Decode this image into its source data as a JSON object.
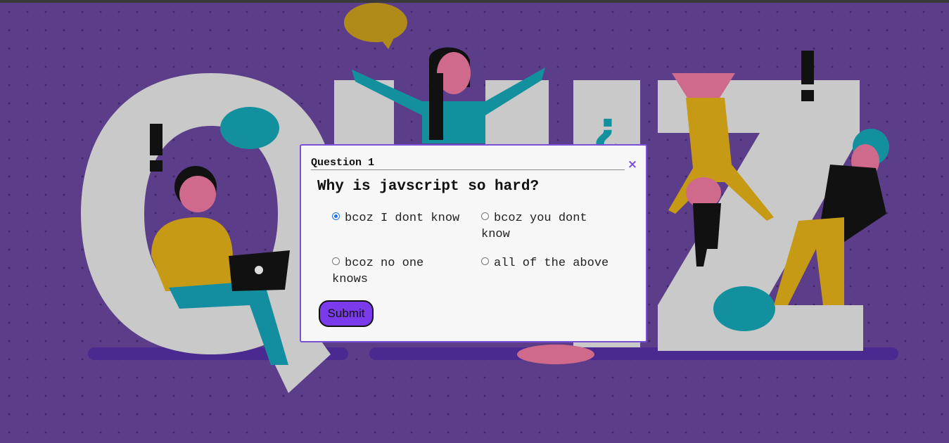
{
  "background": {
    "base_color": "#5b3d8a",
    "letter_color": "#cfcfcf",
    "accent_colors": [
      "#d4a017",
      "#13a2b3",
      "#e0588f",
      "#111111"
    ]
  },
  "modal": {
    "question_number": "Question 1",
    "close_label": "×",
    "question_text": "Why is javscript so hard?",
    "options": [
      {
        "label": "bcoz I dont know",
        "selected": true
      },
      {
        "label": "bcoz you dont know",
        "selected": false
      },
      {
        "label": "bcoz no one knows",
        "selected": false
      },
      {
        "label": "all of the above",
        "selected": false
      }
    ],
    "submit_label": "Submit",
    "accent_color": "#7c3aed"
  }
}
